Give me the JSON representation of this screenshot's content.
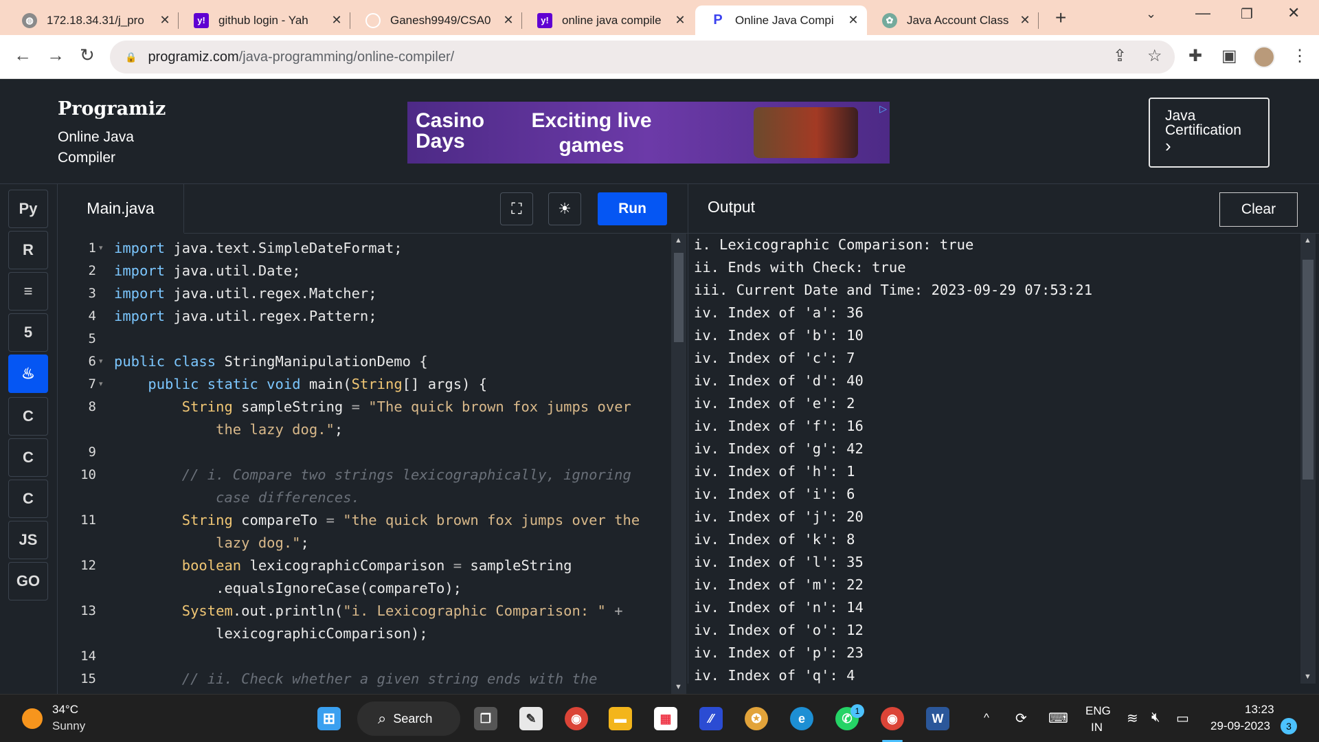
{
  "browser": {
    "tabs": [
      {
        "title": "172.18.34.31/j_pro",
        "icon": "globe-icon"
      },
      {
        "title": "github login - Yah",
        "icon": "yahoo-icon"
      },
      {
        "title": "Ganesh9949/CSA0",
        "icon": "github-icon"
      },
      {
        "title": "online java compile",
        "icon": "yahoo-icon"
      },
      {
        "title": "Online Java Compi",
        "icon": "programiz-icon"
      },
      {
        "title": "Java Account Class",
        "icon": "openai-icon"
      }
    ],
    "url_host": "programiz.com",
    "url_path": "/java-programming/online-compiler/"
  },
  "header": {
    "logo": "Programiz",
    "subtitle": "Online Java Compiler",
    "ad_brand": "Casino Days",
    "ad_text": "Exciting live games",
    "cert_label": "Java Certification",
    "cert_arrow": "›"
  },
  "languages": [
    {
      "name": "python-icon",
      "glyph": "Py"
    },
    {
      "name": "r-icon",
      "glyph": "R"
    },
    {
      "name": "sql-icon",
      "glyph": "≡"
    },
    {
      "name": "html-icon",
      "glyph": "5"
    },
    {
      "name": "java-icon",
      "glyph": "♨"
    },
    {
      "name": "c-icon",
      "glyph": "C"
    },
    {
      "name": "cpp-icon",
      "glyph": "C"
    },
    {
      "name": "csharp-icon",
      "glyph": "C"
    },
    {
      "name": "js-icon",
      "glyph": "JS"
    },
    {
      "name": "go-icon",
      "glyph": "GO"
    }
  ],
  "editor": {
    "file_name": "Main.java",
    "run_label": "Run",
    "code_lines": [
      {
        "num": "1",
        "fold": true,
        "segs": [
          [
            "kw",
            "import"
          ],
          [
            "tx",
            " java.text.SimpleDateFormat;"
          ]
        ]
      },
      {
        "num": "2",
        "segs": [
          [
            "kw",
            "import"
          ],
          [
            "tx",
            " java.util.Date;"
          ]
        ]
      },
      {
        "num": "3",
        "segs": [
          [
            "kw",
            "import"
          ],
          [
            "tx",
            " java.util.regex.Matcher;"
          ]
        ]
      },
      {
        "num": "4",
        "segs": [
          [
            "kw",
            "import"
          ],
          [
            "tx",
            " java.util.regex.Pattern;"
          ]
        ]
      },
      {
        "num": "5",
        "segs": []
      },
      {
        "num": "6",
        "fold": true,
        "segs": [
          [
            "kw",
            "public class"
          ],
          [
            "tx",
            " StringManipulationDemo {"
          ]
        ]
      },
      {
        "num": "7",
        "fold": true,
        "segs": [
          [
            "tx",
            "    "
          ],
          [
            "kw",
            "public static void"
          ],
          [
            "tx",
            " main("
          ],
          [
            "ty",
            "String"
          ],
          [
            "tx",
            "[] args) {"
          ]
        ]
      },
      {
        "num": "8",
        "segs": [
          [
            "tx",
            "        "
          ],
          [
            "ty",
            "String"
          ],
          [
            "tx",
            " sampleString "
          ],
          [
            "op",
            "="
          ],
          [
            "st",
            " \"The quick brown fox jumps over"
          ]
        ]
      },
      {
        "num": "",
        "segs": [
          [
            "st",
            "            the lazy dog.\""
          ],
          [
            "tx",
            ";"
          ]
        ]
      },
      {
        "num": "9",
        "segs": []
      },
      {
        "num": "10",
        "segs": [
          [
            "cm",
            "        // i. Compare two strings lexicographically, ignoring"
          ]
        ]
      },
      {
        "num": "",
        "segs": [
          [
            "cm",
            "            case differences."
          ]
        ]
      },
      {
        "num": "11",
        "segs": [
          [
            "tx",
            "        "
          ],
          [
            "ty",
            "String"
          ],
          [
            "tx",
            " compareTo "
          ],
          [
            "op",
            "="
          ],
          [
            "st",
            " \"the quick brown fox jumps over the"
          ]
        ]
      },
      {
        "num": "",
        "segs": [
          [
            "st",
            "            lazy dog.\""
          ],
          [
            "tx",
            ";"
          ]
        ]
      },
      {
        "num": "12",
        "segs": [
          [
            "tx",
            "        "
          ],
          [
            "ty",
            "boolean"
          ],
          [
            "tx",
            " lexicographicComparison "
          ],
          [
            "op",
            "="
          ],
          [
            "tx",
            " sampleString"
          ]
        ]
      },
      {
        "num": "",
        "segs": [
          [
            "tx",
            "            .equalsIgnoreCase(compareTo);"
          ]
        ]
      },
      {
        "num": "13",
        "segs": [
          [
            "tx",
            "        "
          ],
          [
            "ty",
            "System"
          ],
          [
            "tx",
            ".out.println("
          ],
          [
            "st",
            "\"i. Lexicographic Comparison: \""
          ],
          [
            "op",
            " +"
          ]
        ]
      },
      {
        "num": "",
        "segs": [
          [
            "tx",
            "            lexicographicComparison);"
          ]
        ]
      },
      {
        "num": "14",
        "segs": []
      },
      {
        "num": "15",
        "segs": [
          [
            "cm",
            "        // ii. Check whether a given string ends with the"
          ]
        ]
      }
    ]
  },
  "output": {
    "title": "Output",
    "clear_label": "Clear",
    "lines": [
      "i. Lexicographic Comparison: true",
      "ii. Ends with Check: true",
      "iii. Current Date and Time: 2023-09-29 07:53:21",
      "iv. Index of 'a': 36",
      "iv. Index of 'b': 10",
      "iv. Index of 'c': 7",
      "iv. Index of 'd': 40",
      "iv. Index of 'e': 2",
      "iv. Index of 'f': 16",
      "iv. Index of 'g': 42",
      "iv. Index of 'h': 1",
      "iv. Index of 'i': 6",
      "iv. Index of 'j': 20",
      "iv. Index of 'k': 8",
      "iv. Index of 'l': 35",
      "iv. Index of 'm': 22",
      "iv. Index of 'n': 14",
      "iv. Index of 'o': 12",
      "iv. Index of 'p': 23",
      "iv. Index of 'q': 4"
    ]
  },
  "taskbar": {
    "temperature": "34°C",
    "weather": "Sunny",
    "search_label": "Search",
    "lang_top": "ENG",
    "lang_bottom": "IN",
    "time": "13:23",
    "date": "29-09-2023",
    "notification_count": "3",
    "whatsapp_badge": "1"
  }
}
